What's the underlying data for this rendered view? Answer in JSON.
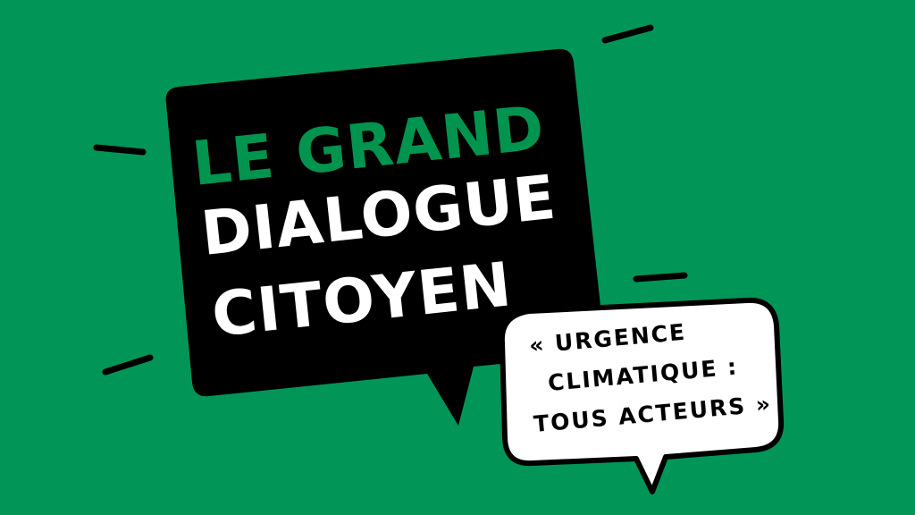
{
  "background_color": "#019658",
  "main_bubble": {
    "fill": "#000000",
    "lines": [
      {
        "text": "LE GRAND",
        "color": "#01944f"
      },
      {
        "text": "DIALOGUE",
        "color": "#ffffff"
      },
      {
        "text": "CITOYEN",
        "color": "#ffffff"
      }
    ]
  },
  "quote_bubble": {
    "fill": "#ffffff",
    "outline": "#000000",
    "lines": [
      {
        "text": "« URGENCE"
      },
      {
        "text": "CLIMATIQUE :"
      },
      {
        "text": "TOUS ACTEURS »"
      }
    ]
  },
  "accent_marks_color": "#000000"
}
